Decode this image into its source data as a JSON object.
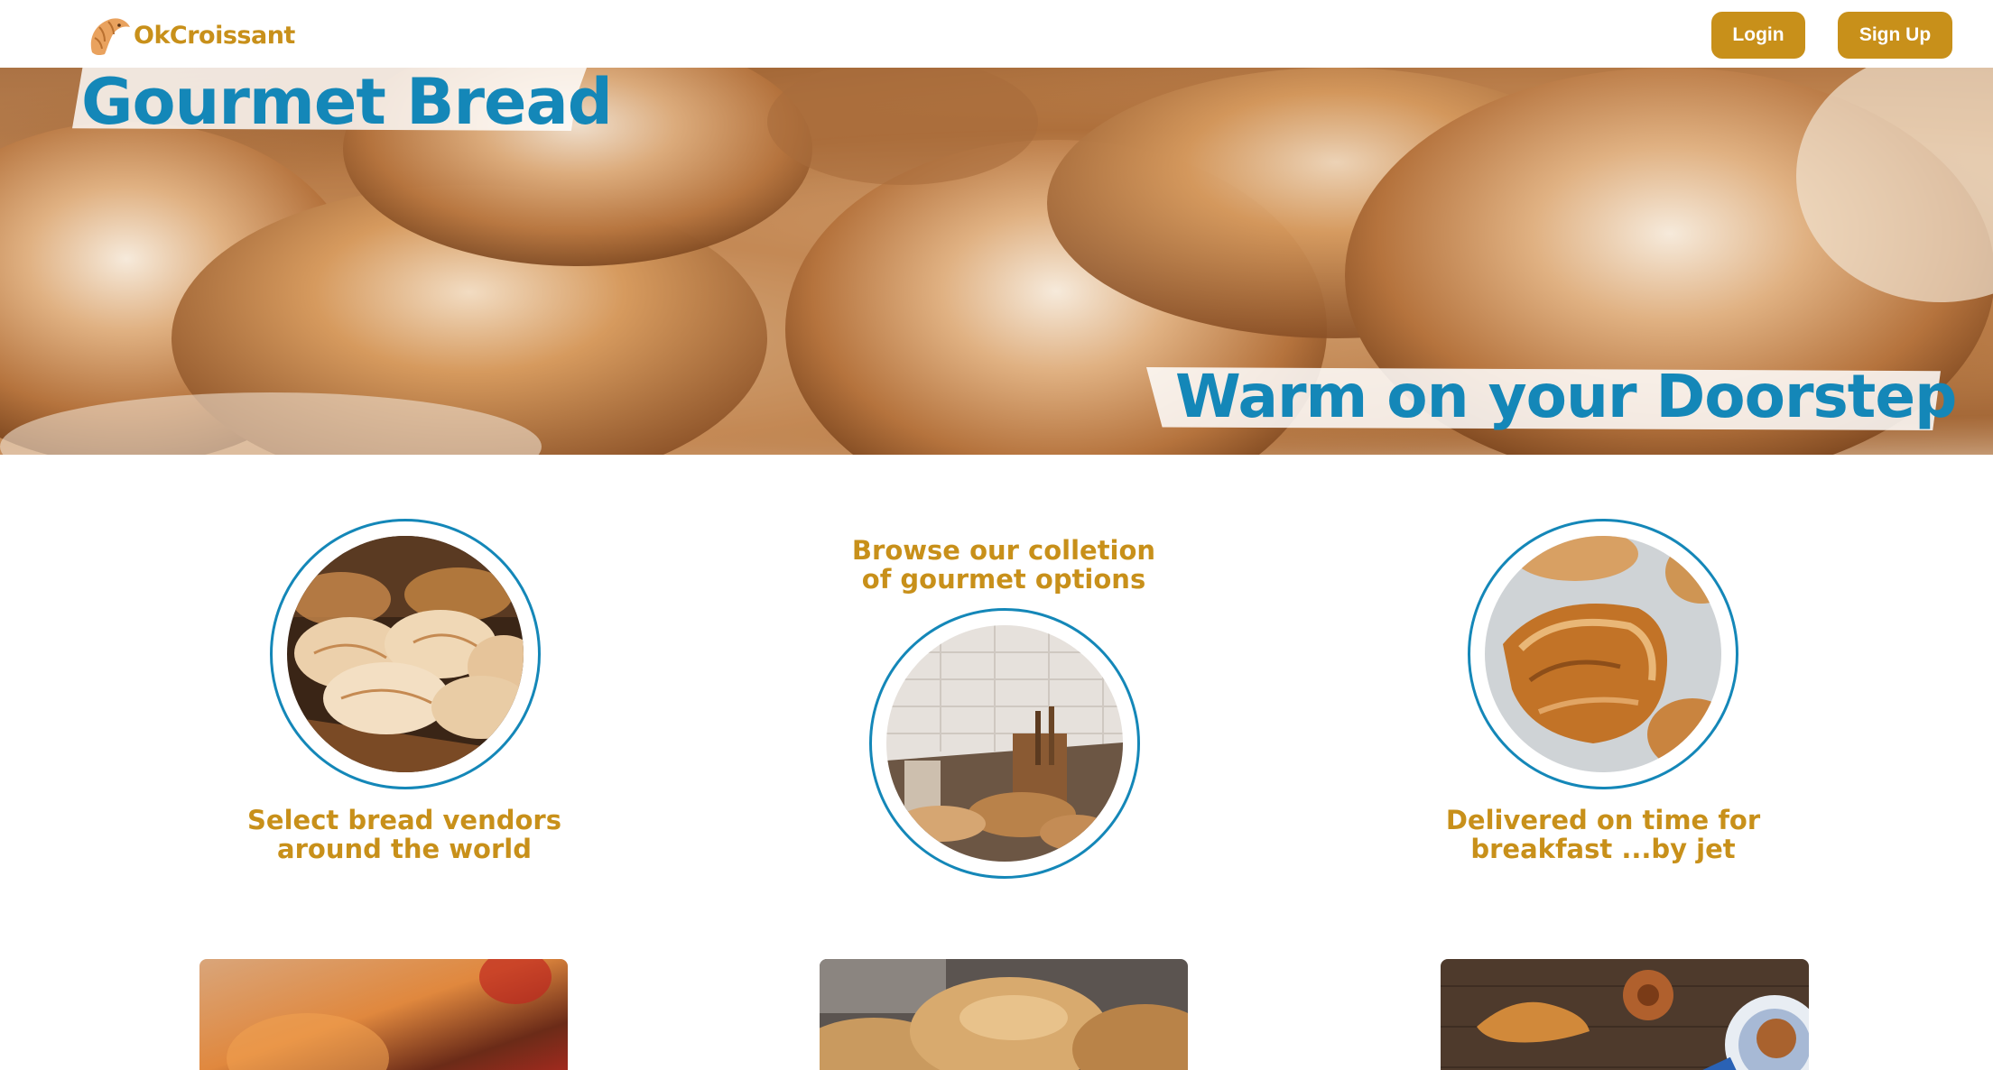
{
  "header": {
    "brand_name": "OkCroissant",
    "login_label": "Login",
    "signup_label": "Sign Up"
  },
  "hero": {
    "title": "Gourmet Bread",
    "subtitle": "Warm on your Doorstep",
    "image": "croissants-with-powdered-sugar"
  },
  "features": [
    {
      "text_line1": "Select bread vendors",
      "text_line2": "around the world",
      "image": "bread-rolls"
    },
    {
      "text_line1": "Browse our colletion",
      "text_line2": "of gourmet options",
      "image": "bakery-counter"
    },
    {
      "text_line1": "Delivered on time for",
      "text_line2": "breakfast ...by jet",
      "image": "pain-au-chocolat"
    }
  ],
  "cards": [
    {
      "image": "blurred-bakery"
    },
    {
      "image": "bread-loaves"
    },
    {
      "image": "croissants-on-table"
    }
  ],
  "colors": {
    "accent": "#C8901A",
    "title_blue": "#1487B8",
    "background": "#FFFFFF"
  }
}
